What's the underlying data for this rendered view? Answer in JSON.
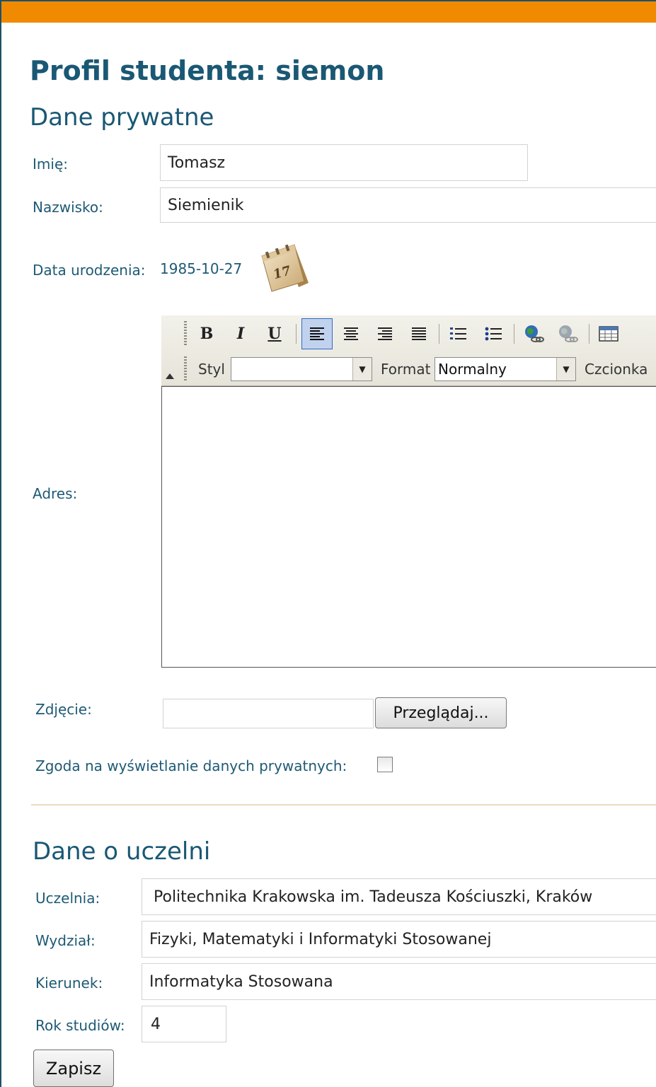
{
  "page": {
    "title": "Profil studenta: siemon",
    "accent_color": "#f08a00",
    "heading_color": "#1a5874"
  },
  "private": {
    "heading": "Dane prywatne",
    "first_name_label": "Imię:",
    "first_name_value": "Tomasz",
    "last_name_label": "Nazwisko:",
    "last_name_value": "Siemienik",
    "birth_label": "Data urodzenia:",
    "birth_value": "1985-10-27",
    "calendar_icon": "calendar-icon",
    "calendar_day": "17",
    "address_label": "Adres:",
    "photo_label": "Zdjęcie:",
    "browse_label": "Przeglądaj...",
    "consent_label": "Zgoda na wyświetlanie danych prywatnych:",
    "consent_checked": false
  },
  "editor": {
    "bold": "B",
    "italic": "I",
    "underline": "U",
    "style_label": "Styl",
    "style_value": "",
    "format_label": "Format",
    "format_value": "Normalny",
    "font_label": "Czcionka"
  },
  "university": {
    "heading": "Dane o uczelni",
    "uni_label": "Uczelnia:",
    "uni_value": "Politechnika Krakowska im. Tadeusza Kościuszki, Kraków",
    "faculty_label": "Wydział:",
    "faculty_value": "Fizyki, Matematyki i Informatyki Stosowanej",
    "field_label": "Kierunek:",
    "field_value": "Informatyka Stosowana",
    "year_label": "Rok studiów:",
    "year_value": "4"
  },
  "actions": {
    "save_label": "Zapisz"
  }
}
